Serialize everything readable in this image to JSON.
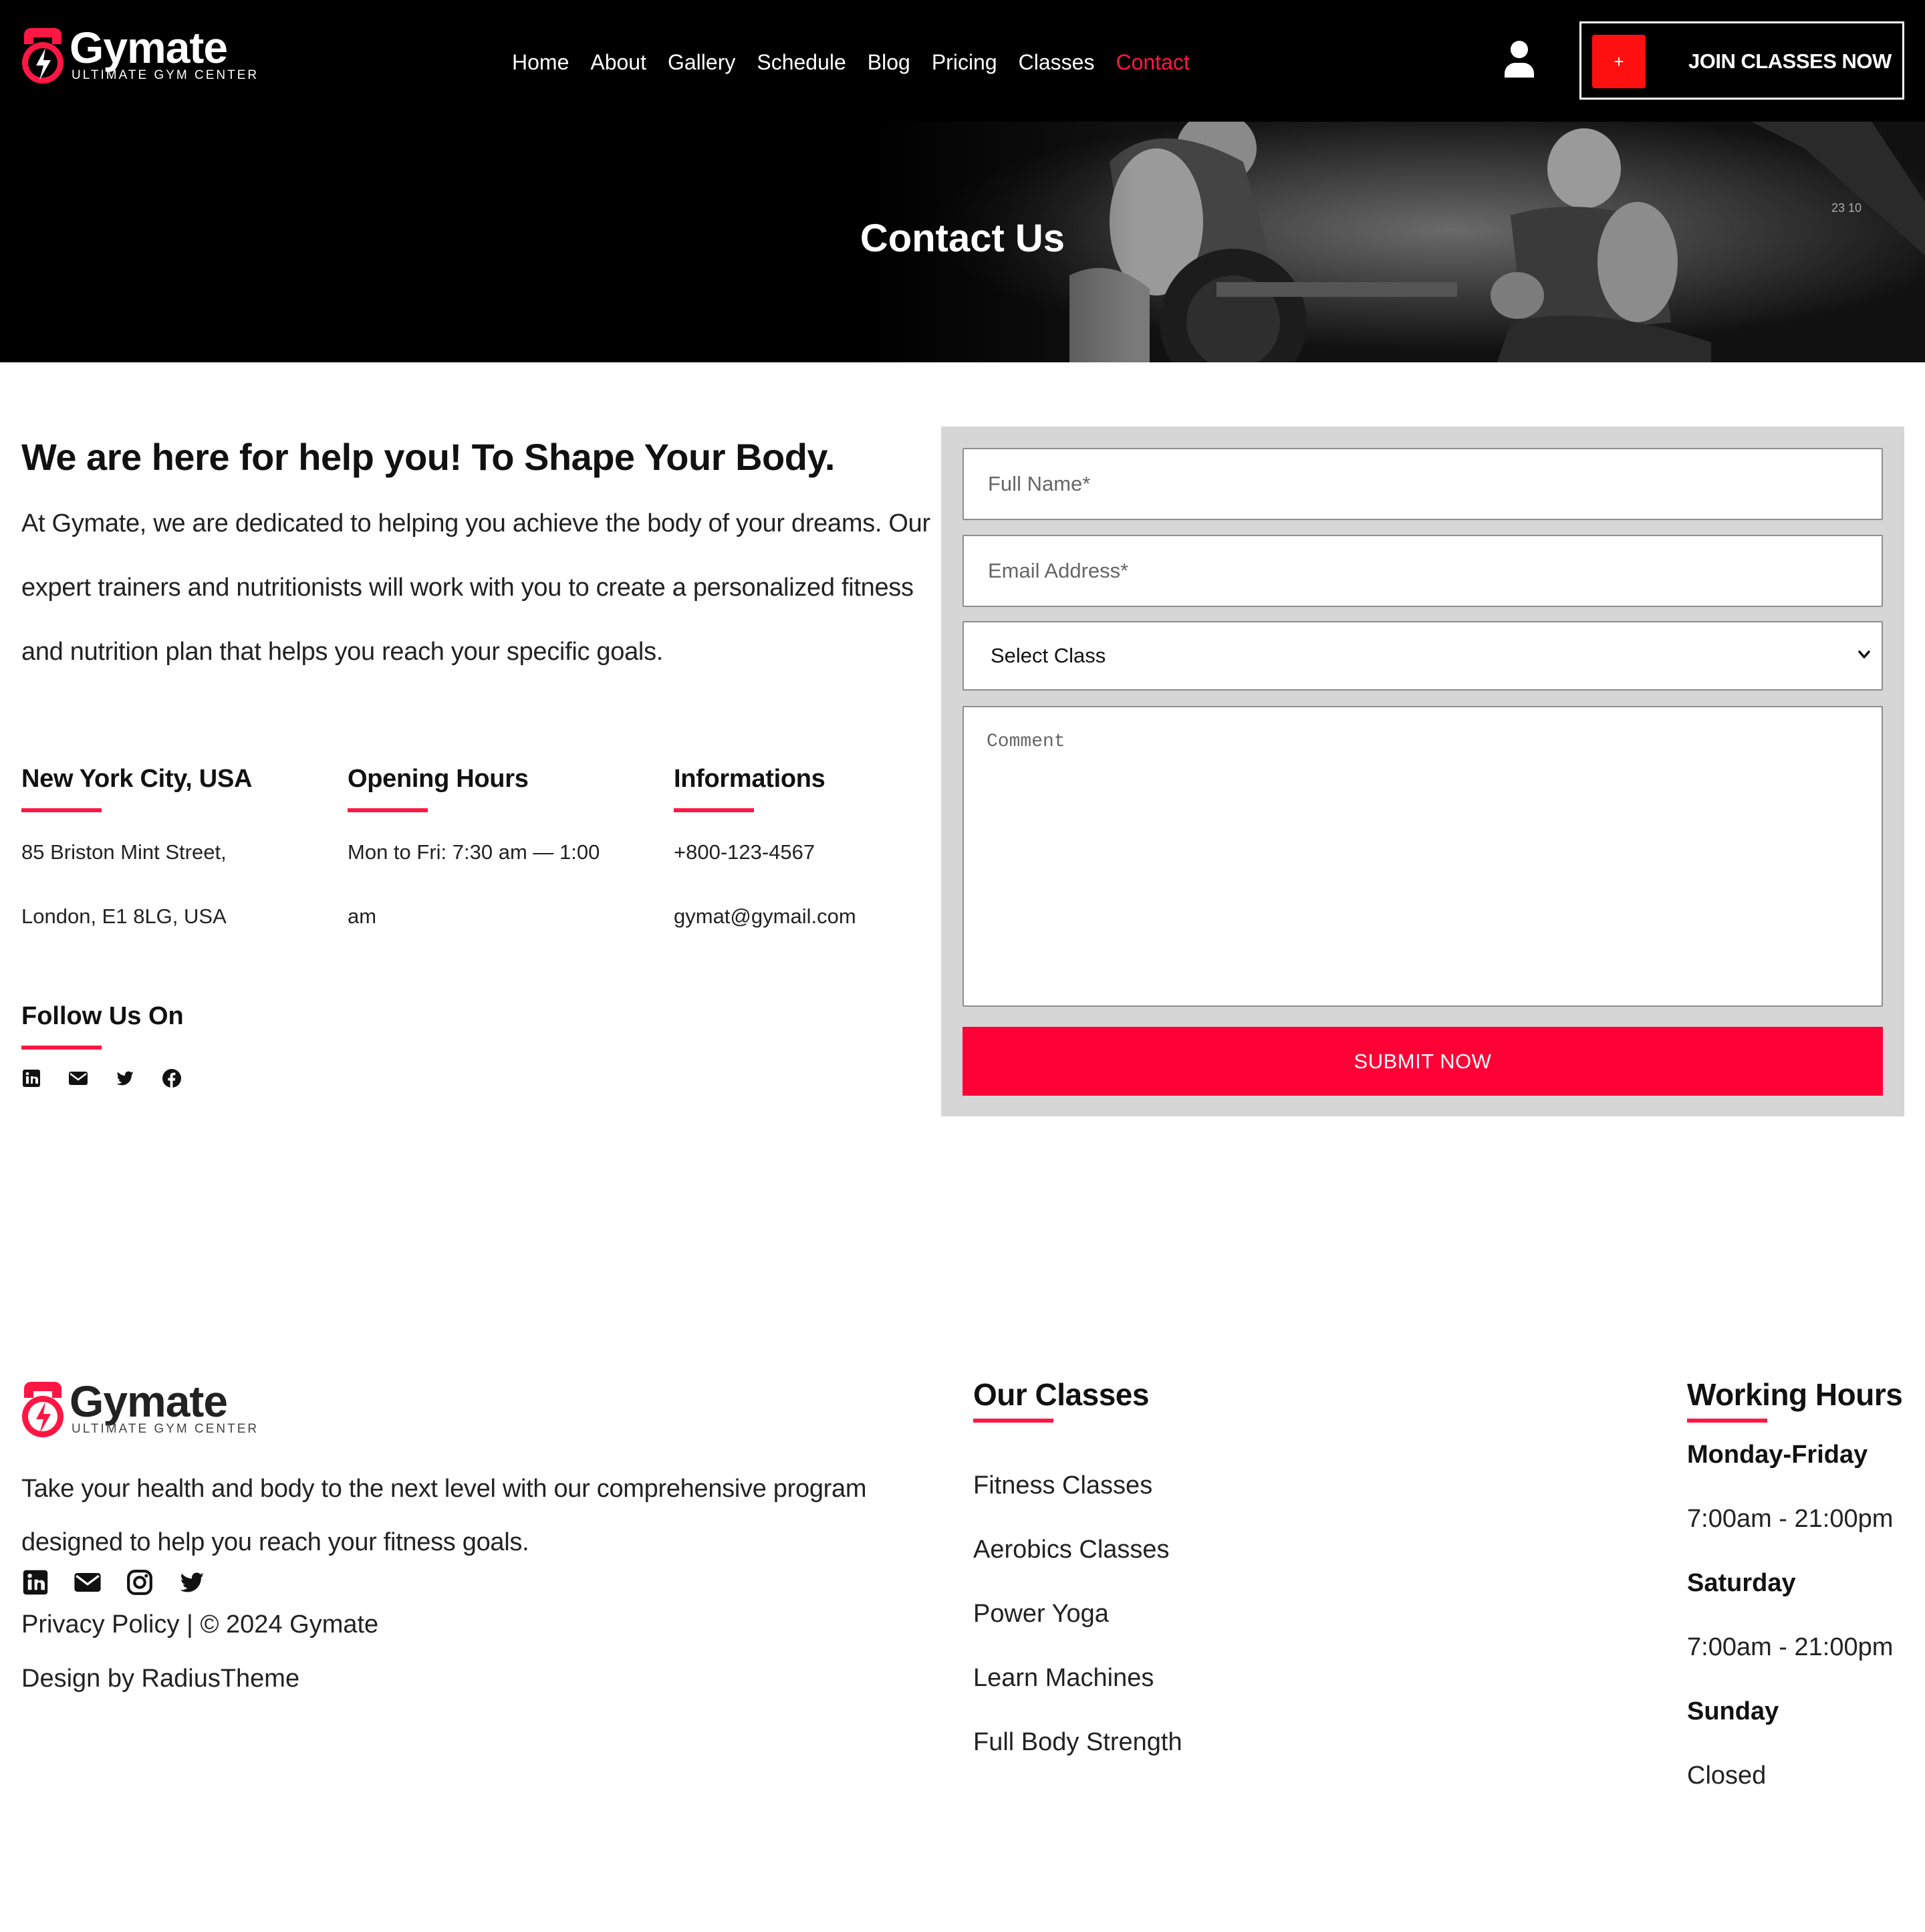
{
  "brand": {
    "name": "Gymate",
    "tagline": "ULTIMATE GYM CENTER",
    "accent": "#ff1744"
  },
  "nav": {
    "items": [
      {
        "label": "Home",
        "active": false
      },
      {
        "label": "About",
        "active": false
      },
      {
        "label": "Gallery",
        "active": false
      },
      {
        "label": "Schedule",
        "active": false
      },
      {
        "label": "Blog",
        "active": false
      },
      {
        "label": "Pricing",
        "active": false
      },
      {
        "label": "Classes",
        "active": false
      },
      {
        "label": "Contact",
        "active": true
      }
    ],
    "user_icon": "user-icon",
    "join_plus": "+",
    "join_label": "JOIN CLASSES NOW"
  },
  "hero": {
    "title": "Contact Us"
  },
  "intro": {
    "heading": "We are here for help you! To Shape Your Body.",
    "paragraph": "At Gymate, we are dedicated to helping you achieve the body of your dreams. Our expert trainers and nutritionists will work with you to create a personalized fitness and nutrition plan that helps you reach your specific goals."
  },
  "info": {
    "location": {
      "title": "New York City, USA",
      "lines": [
        "85 Briston Mint Street,",
        "London, E1 8LG, USA"
      ]
    },
    "hours": {
      "title": "Opening Hours",
      "lines": [
        "Mon to Fri: 7:30 am — 1:00",
        "am"
      ]
    },
    "contact": {
      "title": "Informations",
      "lines": [
        "+800-123-4567",
        "gymat@gymail.com"
      ]
    }
  },
  "follow": {
    "title": "Follow Us On",
    "icons": [
      "linkedin-icon",
      "envelope-icon",
      "twitter-icon",
      "facebook-icon"
    ]
  },
  "form": {
    "full_name_placeholder": "Full Name*",
    "email_placeholder": "Email Address*",
    "select_value": "Select Class",
    "comment_placeholder": "Comment",
    "submit_label": "SUBMIT NOW",
    "submit_color": "#ff0036"
  },
  "footer": {
    "description": "Take your health and body to the next level with our comprehensive program designed to help you reach your fitness goals.",
    "social_icons": [
      "linkedin-icon",
      "envelope-icon",
      "instagram-icon",
      "twitter-icon"
    ],
    "copyright": "Privacy Policy | © 2024 Gymate",
    "credit": "Design by RadiusTheme",
    "classes": {
      "title": "Our Classes",
      "items": [
        "Fitness Classes",
        "Aerobics Classes",
        "Power Yoga",
        "Learn Machines",
        "Full Body Strength"
      ]
    },
    "working_hours": {
      "title": "Working Hours",
      "schedule": [
        {
          "day": "Monday-Friday",
          "time": "7:00am - 21:00pm"
        },
        {
          "day": "Saturday",
          "time": "7:00am - 21:00pm"
        },
        {
          "day": "Sunday",
          "time": "Closed"
        }
      ]
    }
  }
}
